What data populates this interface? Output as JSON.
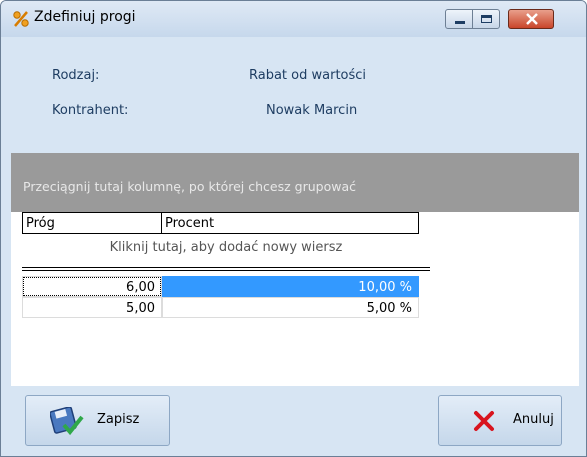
{
  "window": {
    "title": "Zdefiniuj progi",
    "icon": "percent-icon"
  },
  "info": {
    "type_label": "Rodzaj:",
    "type_value": "Rabat od wartości",
    "contractor_label": "Kontrahent:",
    "contractor_value": "Nowak Marcin"
  },
  "grid": {
    "group_panel_text": "Przeciągnij tutaj kolumnę, po której chcesz grupować",
    "columns": [
      "Próg",
      "Procent"
    ],
    "new_row_text": "Kliknij tutaj, aby dodać nowy wiersz",
    "rows": [
      {
        "threshold": "6,00",
        "percent": "10,00 %"
      },
      {
        "threshold": "5,00",
        "percent": "5,00 %"
      }
    ]
  },
  "buttons": {
    "save_label": "Zapisz",
    "cancel_label": "Anuluj"
  },
  "colors": {
    "selection": "#3399ff",
    "group_panel": "#9a9a9a",
    "window_bg": "#d7e5f3",
    "close_button": "#c9452a"
  }
}
